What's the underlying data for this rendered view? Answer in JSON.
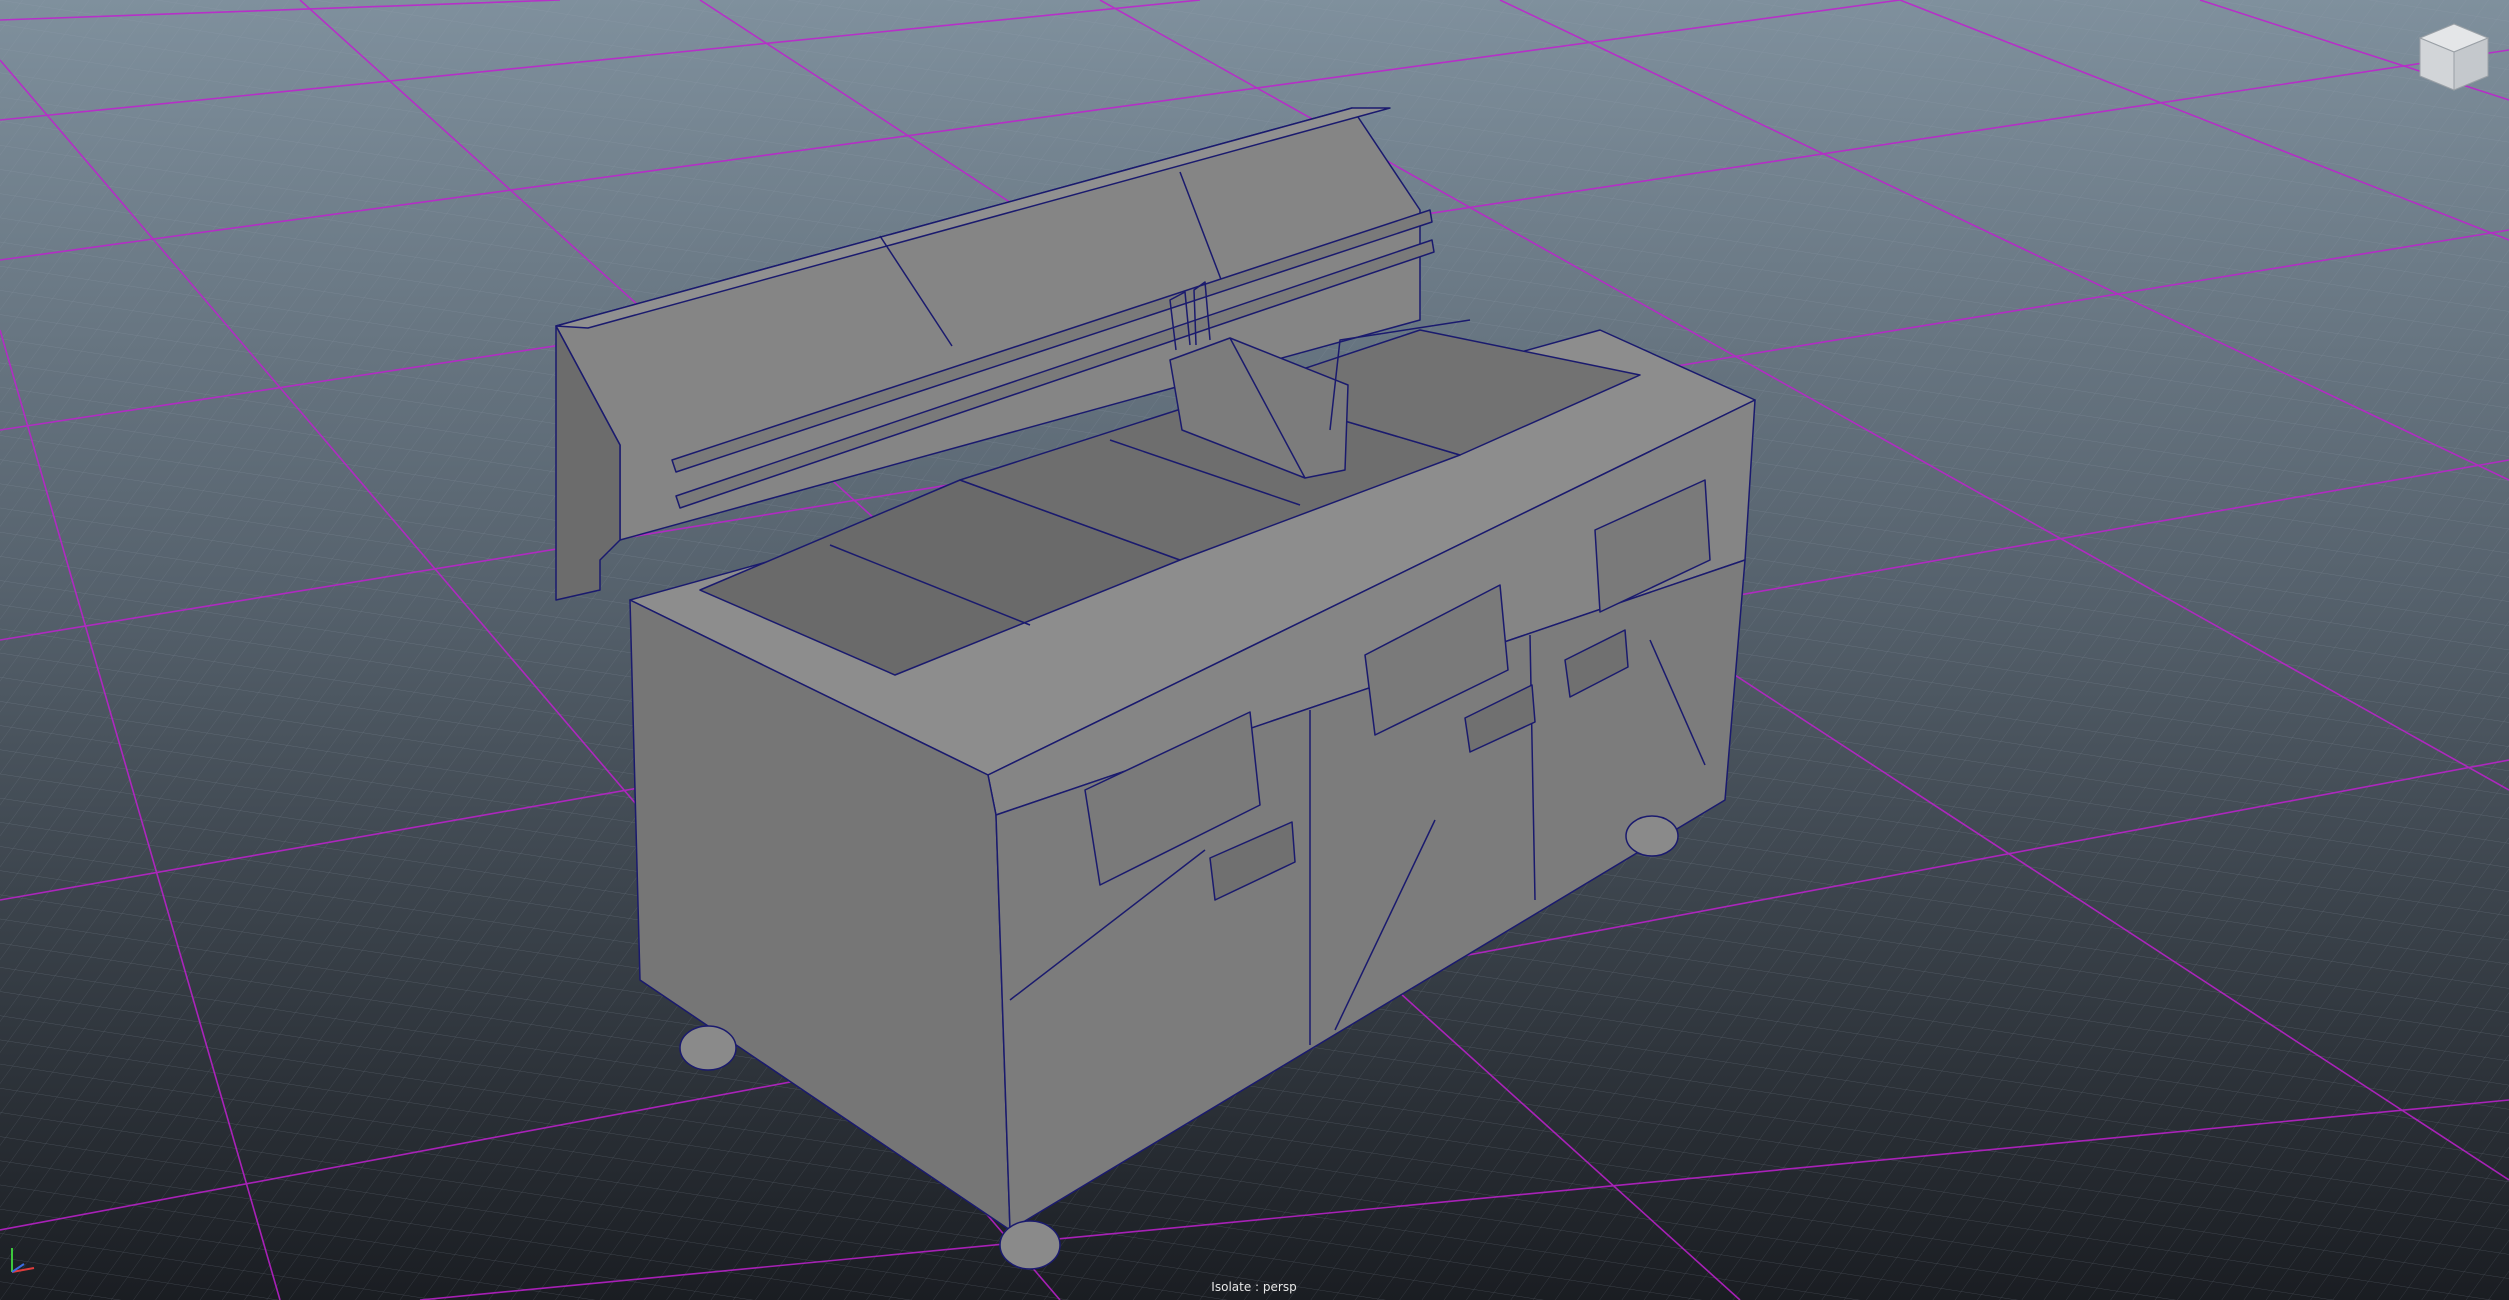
{
  "viewport": {
    "camera_label": "Isolate : persp",
    "grid_color": "#c020d0",
    "background_top": "#7f909d",
    "background_bottom": "#1a1d22"
  },
  "model": {
    "mesh_color": "#7f7f7f",
    "wire_color": "#1a1a6e"
  },
  "view_cube": {
    "icon": "view-cube-icon"
  },
  "axis_indicator": {
    "icon": "xyz-axis-icon"
  }
}
